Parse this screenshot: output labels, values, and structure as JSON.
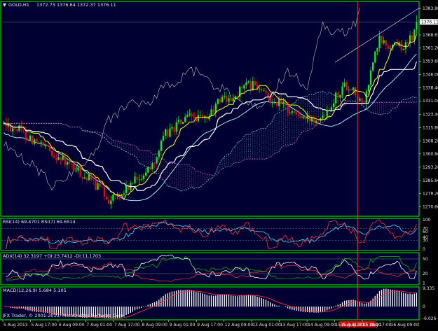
{
  "colors": {
    "background": "#000000",
    "pane": "#000033",
    "frame": "#00ff00",
    "bull_candle": "#00ff00",
    "bear_candle": "#ff0000",
    "tenkan": "#ffff00",
    "kijun": "#ffffff",
    "chikou": "#bfbfbf",
    "cloud_a": "#66cccc",
    "cloud_b": "#cc66cc",
    "bb": "#aaffff",
    "rsi_fast": "#ff3030",
    "rsi_slow": "#40e0ff",
    "adx_main": "#ffffff",
    "adx_plus": "#00c000",
    "adx_minus": "#ff3030",
    "macd_hist": "#ffffff",
    "macd_signal": "#ff3030",
    "vline": "#ff4040",
    "tag_bg": "#cc0000"
  },
  "main": {
    "header": {
      "symbol": "GOLD,H1",
      "ohlc": "1372.73 1376.64 1372.37 1376.11"
    },
    "price_labels": [
      "1383.80",
      "1376.11",
      "1368.65",
      "1361.20",
      "1353.60",
      "1346.00",
      "1338.40",
      "1331.00",
      "1323.40",
      "1315.80",
      "1308.20",
      "1300.80",
      "1293.20",
      "1285.60",
      "1278.20",
      "1270.60"
    ],
    "current_price_label": "1376.11",
    "price_range": [
      1266.0,
      1387.0
    ]
  },
  "rsi": {
    "header": "RSI(14) 69.4701  RSI(7) 69.6514",
    "labels": [
      "100",
      "70",
      "60",
      "40",
      "30",
      "0"
    ],
    "levels": [
      70,
      30
    ]
  },
  "adx": {
    "header": "ADX(14) 32.3197 +DI:23.7412 -DI:11.1703",
    "labels": [
      "50",
      "20",
      "1"
    ],
    "level": 20
  },
  "macd": {
    "header": "MACD(12,26,9) 5.684 5.105",
    "labels": [
      "9.335",
      "0",
      "-6.026"
    ]
  },
  "time_axis": {
    "labels": [
      "5 Aug 2013",
      "5 Aug 17:00",
      "6 Aug 09:00",
      "7 Aug 01:00",
      "7 Aug 17:00",
      "8 Aug 09:00",
      "9 Aug 01:00",
      "9 Aug 17:00",
      "12 Aug 09:00",
      "13 Aug 01:00",
      "13 Aug 17:00",
      "14 Aug 09:00",
      "15 Aug 01:00",
      "15 Aug 17:00",
      "16 Aug 09:00"
    ],
    "highlight_label": "15 Aug 2013 18:00",
    "highlight_fraction": 0.855
  },
  "watermark": "JFX Trader, © 2001-2013, MetaQuotes Software Corp."
}
